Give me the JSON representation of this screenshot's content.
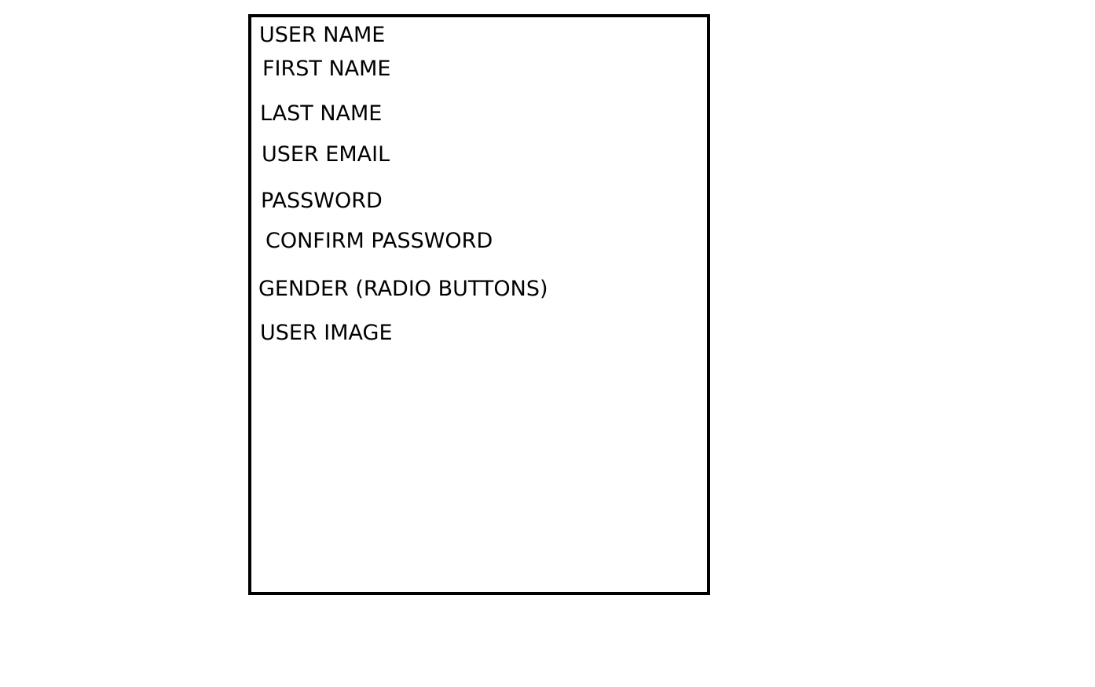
{
  "form": {
    "fields": [
      "USER NAME",
      "FIRST NAME",
      "LAST NAME",
      "USER EMAIL",
      "PASSWORD",
      "CONFIRM PASSWORD",
      "GENDER (RADIO BUTTONS)",
      "USER IMAGE"
    ]
  },
  "colors": {
    "border": "#000000",
    "text": "#000000",
    "background": "#ffffff"
  }
}
